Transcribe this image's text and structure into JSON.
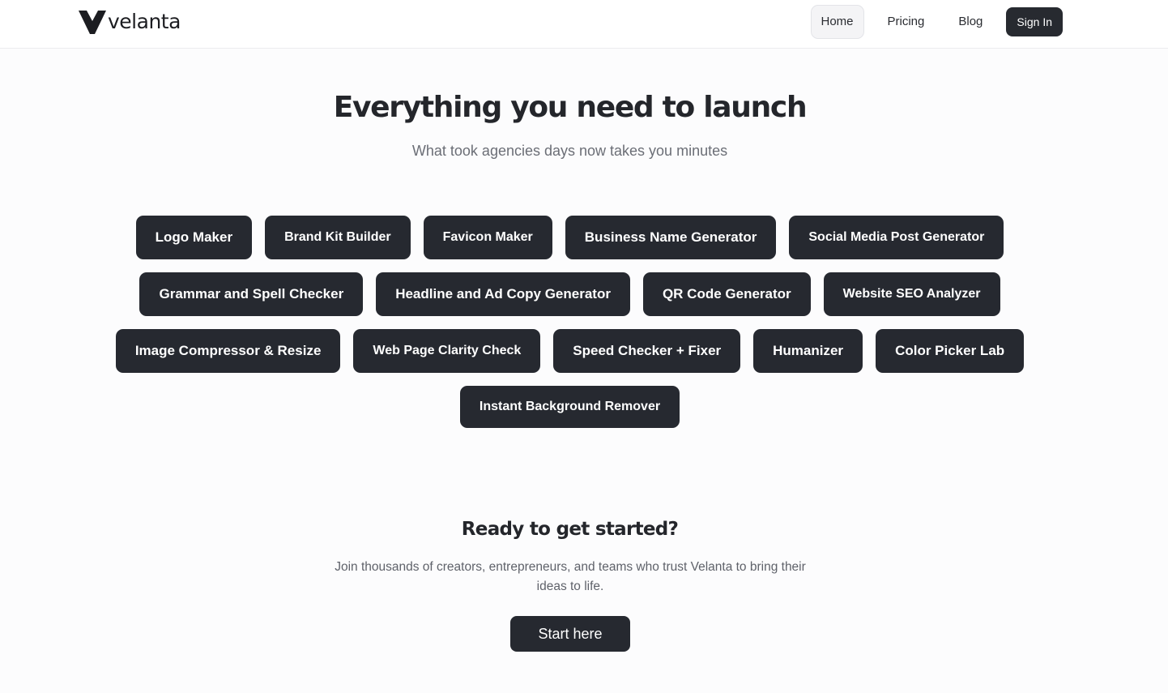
{
  "brand": {
    "name": "velanta",
    "logo_icon": "v-logo-icon",
    "accent": "#262930"
  },
  "nav": {
    "items": [
      {
        "label": "Home",
        "active": true
      },
      {
        "label": "Pricing",
        "active": false
      },
      {
        "label": "Blog",
        "active": false
      }
    ],
    "sign_in": "Sign In"
  },
  "hero": {
    "title": "Everything you need to launch",
    "subtitle": "What took agencies days now takes you minutes"
  },
  "tools": {
    "rows": [
      [
        "Logo Maker",
        "Brand Kit Builder",
        "Favicon Maker",
        "Business Name Generator",
        "Social Media Post Generator"
      ],
      [
        "Grammar and Spell Checker",
        "Headline and Ad Copy Generator",
        "QR Code Generator",
        "Website SEO Analyzer"
      ],
      [
        "Image Compressor & Resize",
        "Web Page Clarity Check",
        "Speed Checker + Fixer",
        "Humanizer",
        "Color Picker Lab"
      ],
      [
        "Instant Background Remover"
      ]
    ]
  },
  "cta": {
    "title": "Ready to get started?",
    "text": "Join thousands of creators, entrepreneurs, and teams who trust Velanta to bring their ideas to life.",
    "button": "Start here"
  }
}
